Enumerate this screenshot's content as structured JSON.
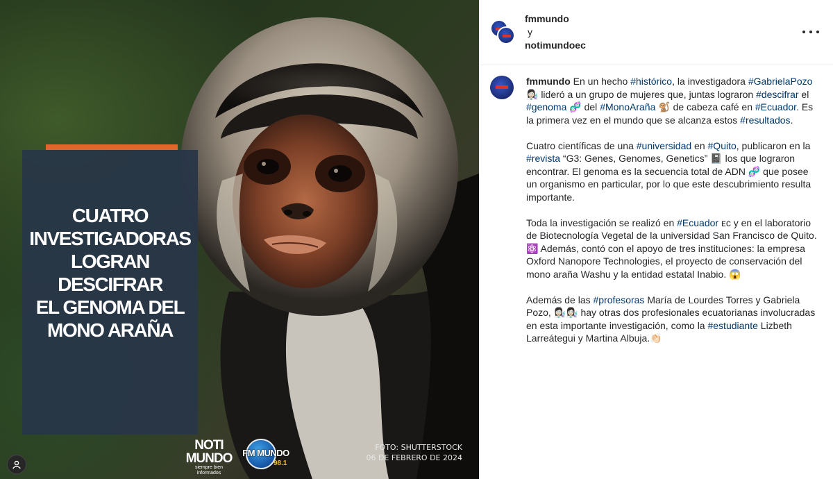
{
  "post_image": {
    "headline": "CUATRO\nINVESTIGADORAS\nLOGRAN\nDESCIFRAR\nEL GENOMA DEL\nMONO ARAÑA",
    "logo_noti": "NOTI\nMUNDO",
    "logo_noti_tagline": "siempre bien informados",
    "logo_fm": "FM MUNDO",
    "logo_fm_freq": "98.1",
    "credit_line_1": "FOTO: SHUTTERSTOCK",
    "credit_line_2": "06 DE FEBRERO DE 2024",
    "colors": {
      "panel": "#283648",
      "accent_bar": "#e0662a"
    }
  },
  "header": {
    "user_1": "fmmundo",
    "connector": "y",
    "user_2": "notimundoec",
    "more_icon": "more-horizontal-icon"
  },
  "caption": {
    "user": "fmmundo",
    "paragraph_1": [
      {
        "t": "En un hecho ",
        "tag": false
      },
      {
        "t": "#histórico",
        "tag": true
      },
      {
        "t": ", la investigadora ",
        "tag": false
      },
      {
        "t": "#GabrielaPozo",
        "tag": true
      },
      {
        "t": " 👩🏻‍🔬 lideró a un grupo de mujeres que, juntas lograron ",
        "tag": false
      },
      {
        "t": "#descifrar",
        "tag": true
      },
      {
        "t": " el ",
        "tag": false
      },
      {
        "t": "#genoma",
        "tag": true
      },
      {
        "t": " 🧬 del ",
        "tag": false
      },
      {
        "t": "#MonoAraña",
        "tag": true
      },
      {
        "t": " 🐒 de cabeza café en ",
        "tag": false
      },
      {
        "t": "#Ecuador",
        "tag": true
      },
      {
        "t": ". Es la primera vez en el mundo que se alcanza estos ",
        "tag": false
      },
      {
        "t": "#resultados",
        "tag": true
      },
      {
        "t": ".",
        "tag": false
      }
    ],
    "paragraph_2": [
      {
        "t": "Cuatro científicas de una ",
        "tag": false
      },
      {
        "t": "#universidad",
        "tag": true
      },
      {
        "t": " en ",
        "tag": false
      },
      {
        "t": "#Quito",
        "tag": true
      },
      {
        "t": ", publicaron en la ",
        "tag": false
      },
      {
        "t": "#revista",
        "tag": true
      },
      {
        "t": " “G3: Genes, Genomes, Genetics” 📓 los que lograron encontrar. El genoma es la secuencia total de ADN 🧬 que posee un organismo en particular, por lo que este descubrimiento resulta importante.",
        "tag": false
      }
    ],
    "paragraph_3": [
      {
        "t": "Toda la investigación se realizó en ",
        "tag": false
      },
      {
        "t": "#Ecuador",
        "tag": true
      },
      {
        "t": " ᴇᴄ y en el laboratorio de Biotecnología Vegetal de la universidad San Francisco de Quito. ⚛️ Además, contó con el apoyo de tres instituciones: la empresa Oxford Nanopore Technologies, el proyecto de conservación del mono araña Washu y la entidad estatal Inabio. 😱",
        "tag": false
      }
    ],
    "paragraph_4": [
      {
        "t": "Además de las ",
        "tag": false
      },
      {
        "t": "#profesoras",
        "tag": true
      },
      {
        "t": " María de Lourdes Torres y Gabriela Pozo, 👩🏻‍🔬👩🏻‍🔬 hay otras dos profesionales ecuatorianas involucradas en esta importante investigación, como la ",
        "tag": false
      },
      {
        "t": "#estudiante",
        "tag": true
      },
      {
        "t": " Lizbeth Larreátegui y Martina Albuja.👏🏻",
        "tag": false
      }
    ]
  }
}
